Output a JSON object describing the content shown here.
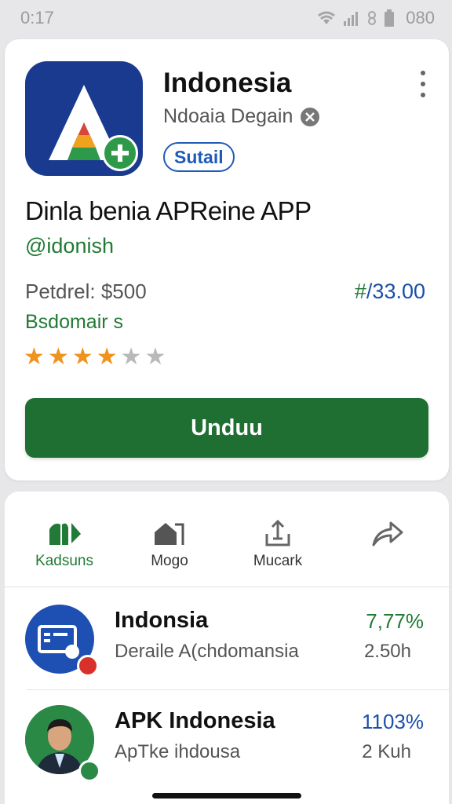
{
  "status": {
    "time": "0:17",
    "battery": "080"
  },
  "app": {
    "name": "Indonesia",
    "developer": "Ndoaia Degain",
    "tag": "Sutail",
    "title": "Dinla benia APReine APP",
    "handle": "@idonish",
    "price_label": "Petdrel: $500",
    "price_hash": "#",
    "price_value": "/33.00",
    "category": "Bsdomair s",
    "rating": 4,
    "rating_max": 6,
    "download_label": "Unduu",
    "colors": {
      "brand_green": "#1f6f33",
      "blue": "#1a4fa8",
      "icon_bg": "#1a3a8f"
    }
  },
  "tabs": [
    {
      "label": "Kadsuns",
      "icon": "store-icon",
      "active": true
    },
    {
      "label": "Mogo",
      "icon": "home-icon",
      "active": false
    },
    {
      "label": "Mucark",
      "icon": "upload-icon",
      "active": false
    },
    {
      "label": "",
      "icon": "share-icon",
      "active": false
    }
  ],
  "rows": [
    {
      "title": "Indonsia",
      "subtitle": "Deraile A(chdomansia",
      "stat": "7,77%",
      "meta": "2.50h",
      "stat_color": "#217a35"
    },
    {
      "title": "APK Indonesia",
      "subtitle": "ApTke ihdousa",
      "stat": "1103%",
      "meta": "2 Kuh",
      "stat_color": "#1a4fa8"
    }
  ]
}
